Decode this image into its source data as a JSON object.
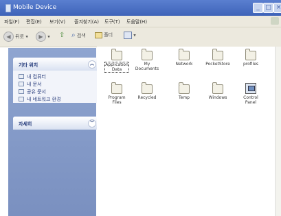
{
  "window": {
    "title": "Mobile Device",
    "buttons": [
      "_",
      "□",
      "×"
    ]
  },
  "menu": {
    "items": [
      "파일(F)",
      "편집(E)",
      "보기(V)",
      "즐겨찾기(A)",
      "도구(T)",
      "도움말(H)"
    ]
  },
  "toolbar": {
    "back_label": "뒤로",
    "search_label": "검색",
    "folders_label": "폴더"
  },
  "sidebar": {
    "other_places": {
      "header": "기타 위치",
      "items": [
        "내 컴퓨터",
        "내 문서",
        "공유 문서",
        "내 네트워크 환경"
      ]
    },
    "details": {
      "header": "자세히"
    }
  },
  "files": [
    {
      "name": "Application\nData",
      "type": "folder"
    },
    {
      "name": "My\nDocuments",
      "type": "folder"
    },
    {
      "name": "Network",
      "type": "folder"
    },
    {
      "name": "PocketStore",
      "type": "folder"
    },
    {
      "name": "profiles",
      "type": "folder"
    },
    {
      "name": "Program\nFiles",
      "type": "folder"
    },
    {
      "name": "Recycled",
      "type": "folder"
    },
    {
      "name": "Temp",
      "type": "folder"
    },
    {
      "name": "Windows",
      "type": "folder"
    },
    {
      "name": "Control\nPanel",
      "type": "control-panel"
    }
  ]
}
